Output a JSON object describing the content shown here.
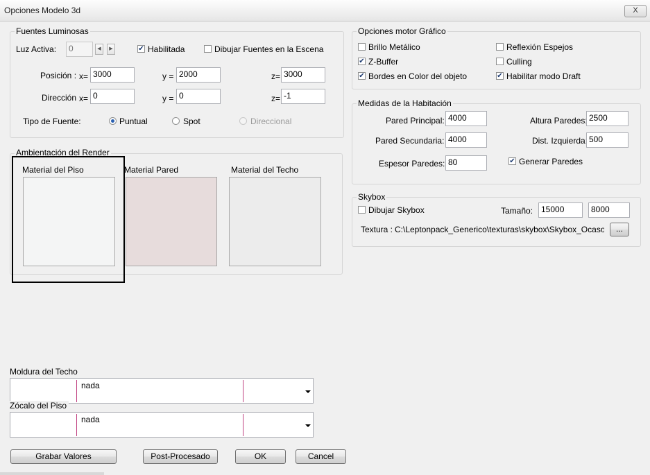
{
  "window": {
    "title": "Opciones Modelo 3d",
    "close_label": "X"
  },
  "fuentes": {
    "legend": "Fuentes Luminosas",
    "luz_activa_label": "Luz Activa:",
    "luz_activa_value": "0",
    "habilitada_label": "Habilitada",
    "habilitada_checked": true,
    "dibujar_label": "Dibujar Fuentes en la Escena",
    "dibujar_checked": false,
    "posicion_label": "Posición :",
    "direccion_label": "Dirección",
    "x_label": "x=",
    "y_label": "y =",
    "z_label": "z=",
    "posicion": {
      "x": "3000",
      "y": "2000",
      "z": "3000"
    },
    "direccion": {
      "x": "0",
      "y": "0",
      "z": "-1"
    },
    "tipo_label": "Tipo de Fuente:",
    "tipo_options": [
      "Puntual",
      "Spot",
      "Direccional"
    ],
    "tipo_selected": "Puntual"
  },
  "ambientacion": {
    "legend": "Ambientación del Render",
    "materials": [
      {
        "label": "Material del Piso",
        "color": "#f4f5f5"
      },
      {
        "label": "Material Pared",
        "color": "#e7dcdc"
      },
      {
        "label": "Material del Techo",
        "color": "#ececec"
      }
    ]
  },
  "moldura": {
    "label": "Moldura del Techo",
    "value": "nada"
  },
  "zocalo": {
    "label": "Zócalo del Piso",
    "value": "nada"
  },
  "buttons": {
    "grabar": "Grabar Valores",
    "postproc": "Post-Procesado",
    "ok": "OK",
    "cancel": "Cancel"
  },
  "motor": {
    "legend": "Opciones motor Gráfico",
    "options": [
      {
        "label": "Brillo Metálico",
        "checked": false
      },
      {
        "label": "Reflexión Espejos",
        "checked": false
      },
      {
        "label": "Z-Buffer",
        "checked": true
      },
      {
        "label": "Culling",
        "checked": false
      },
      {
        "label": "Bordes en Color del objeto",
        "checked": true
      },
      {
        "label": "Habilitar modo Draft",
        "checked": true
      }
    ]
  },
  "medidas": {
    "legend": "Medidas de la Habitación",
    "pared_principal_label": "Pared Principal:",
    "pared_principal": "4000",
    "altura_label": "Altura Paredes:",
    "altura": "2500",
    "pared_secundaria_label": "Pared Secundaria:",
    "pared_secundaria": "4000",
    "dist_label": "Dist. Izquierda:",
    "dist": "500",
    "espesor_label": "Espesor Paredes:",
    "espesor": "80",
    "generar_label": "Generar Paredes",
    "generar_checked": true
  },
  "skybox": {
    "legend": "Skybox",
    "dibujar_label": "Dibujar Skybox",
    "dibujar_checked": false,
    "tamano_label": "Tamaño:",
    "tamano1": "15000",
    "tamano2": "8000",
    "textura_label": "Textura :",
    "textura_value": "C:\\Leptonpack_Generico\\texturas\\skybox\\Skybox_Ocaso\\oca",
    "browse_label": "..."
  }
}
